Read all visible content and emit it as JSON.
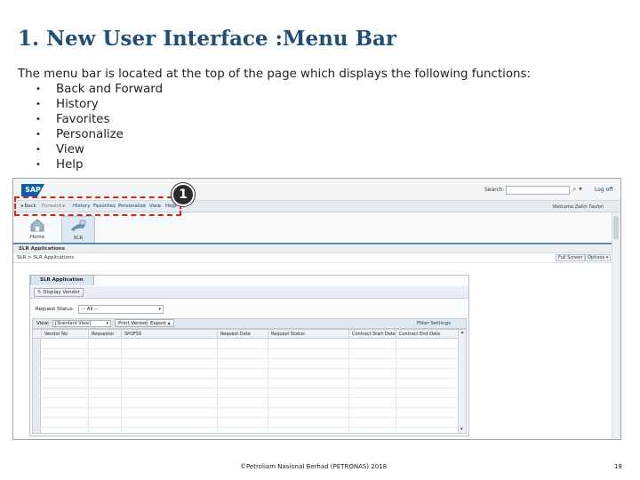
{
  "slide": {
    "title": "1. New User Interface :Menu Bar",
    "intro": "The menu bar is located at the top of the page which displays the following functions:",
    "bullets": [
      "Back and Forward",
      "History",
      "Favorites",
      "Personalize",
      "View",
      "Help"
    ],
    "marker_number": "1",
    "footer": "©Petroliam Nasional Berhad (PETRONAS) 2018",
    "page_number": "18"
  },
  "portal": {
    "logo_text": "SAP",
    "search_label": "Search:",
    "search_value": "",
    "logoff": "Log off",
    "welcome": "Welcome Zakin Taufan",
    "menu": {
      "back": "◂ Back",
      "forward": "Forward ▸",
      "history": "History",
      "favorites": "Favorites",
      "personalize": "Personalize",
      "view": "View",
      "help": "Help"
    },
    "tiles": [
      {
        "label": "Home",
        "icon": "home-icon"
      },
      {
        "label": "SLR",
        "icon": "slr-icon"
      }
    ],
    "section_header": "SLR Applications",
    "breadcrumb": "SLR > SLR Applications",
    "full_screen": "Full Screen",
    "options": "Options ▾"
  },
  "app": {
    "tab_title": "SLR Application",
    "display_btn": "Display Vendor",
    "status_label": "Request Status:",
    "status_value": "-- All --",
    "view_label": "View:",
    "view_value": "[Standard View]",
    "print_btn": "Print Version",
    "export_btn": "Export ▴",
    "filter_settings": "Filter  Settings",
    "columns": [
      "Vendor No",
      "Requestor",
      "SPOFSS",
      "Request Date",
      "Request Status",
      "Contract Start Date",
      "Contract End Date"
    ]
  },
  "colors": {
    "title": "#1f4e79",
    "highlight": "#d9261c",
    "portal_blue": "#0b3d7a"
  }
}
